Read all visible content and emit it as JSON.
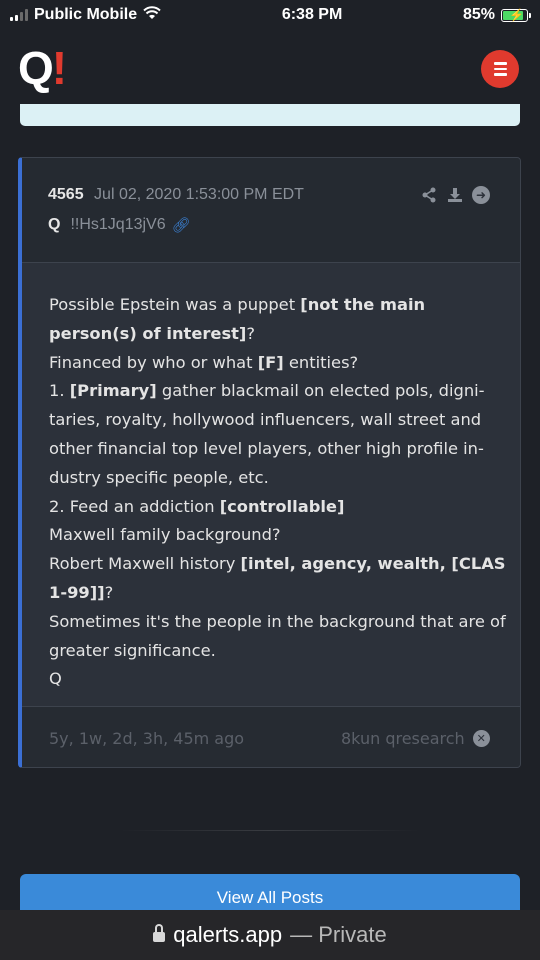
{
  "status_bar": {
    "carrier": "Public Mobile",
    "time": "6:38 PM",
    "battery": "85%"
  },
  "header": {
    "logo_letter": "Q",
    "logo_mark": "!",
    "menu_icon": "hamburger-icon"
  },
  "post": {
    "number": "4565",
    "datetime": "Jul 02, 2020 1:53:00 PM EDT",
    "author": "Q",
    "tripcode": "!!Hs1Jq13jV6",
    "actions": [
      "share-icon",
      "download-icon",
      "arrow-right-icon"
    ],
    "lines": [
      {
        "text": "Possible Epstein was a puppet ",
        "bold": "[not the main person(s) of interest]",
        "tail": "?"
      },
      {
        "text": "Financed by who or what ",
        "bold": "[F]",
        "tail": " entities?"
      },
      {
        "text": "1. ",
        "bold": "[Primary]",
        "tail": " gather blackmail on elected pols, digni-taries, royalty, hollywood influencers, wall street and other financial top level players, other high profile in-dustry specific people, etc."
      },
      {
        "text": "2. Feed an addiction ",
        "bold": "[controllable]",
        "tail": ""
      },
      {
        "text": "Maxwell family background?",
        "bold": "",
        "tail": ""
      },
      {
        "text": "Robert Maxwell history ",
        "bold": "[intel, agency, wealth, [CLAS 1-99]]",
        "tail": "?"
      },
      {
        "text": "Sometimes it's the people in the background that are of greater significance.",
        "bold": "",
        "tail": ""
      },
      {
        "text": "Q",
        "bold": "",
        "tail": ""
      }
    ],
    "age": "5y, 1w, 2d, 3h, 45m ago",
    "source": "8kun qresearch"
  },
  "view_all_label": "View All Posts",
  "url_bar": {
    "domain": "qalerts.app",
    "suffix": "— Private"
  }
}
